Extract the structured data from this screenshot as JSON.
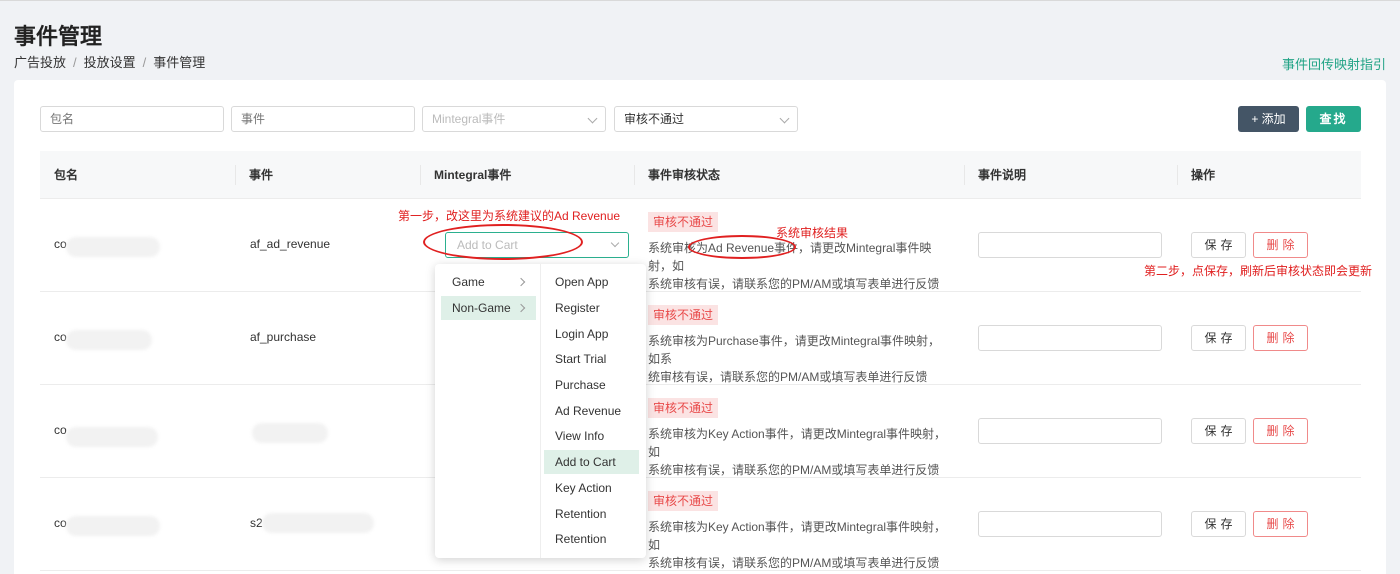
{
  "page": {
    "title": "事件管理",
    "breadcrumb": [
      "广告投放",
      "投放设置",
      "事件管理"
    ],
    "guide_link": "事件回传映射指引"
  },
  "filters": {
    "package_placeholder": "包名",
    "event_placeholder": "事件",
    "mintegral_placeholder": "Mintegral事件",
    "status_value": "审核不通过"
  },
  "buttons": {
    "add": "+ 添加",
    "search": "查找"
  },
  "table": {
    "headers": [
      "包名",
      "事件",
      "Mintegral事件",
      "事件审核状态",
      "事件说明",
      "操作"
    ],
    "rows": [
      {
        "package": "co",
        "event": "af_ad_revenue",
        "mintegral_placeholder": "Add to Cart",
        "status": "审核不通过",
        "msg_line1": "系统审核为Ad Revenue事件，请更改Mintegral事件映射，如",
        "msg_line2": "系统审核有误，请联系您的PM/AM或填写表单进行反馈",
        "save": "保存",
        "delete": "删除"
      },
      {
        "package": "co",
        "event": "af_purchase",
        "status": "审核不通过",
        "msg_line1": "系统审核为Purchase事件，请更改Mintegral事件映射，如系",
        "msg_line2": "统审核有误，请联系您的PM/AM或填写表单进行反馈",
        "save": "保存",
        "delete": "删除"
      },
      {
        "package": "co",
        "event": "",
        "status": "审核不通过",
        "msg_line1": "系统审核为Key Action事件，请更改Mintegral事件映射，如",
        "msg_line2": "系统审核有误，请联系您的PM/AM或填写表单进行反馈",
        "save": "保存",
        "delete": "删除"
      },
      {
        "package": "co",
        "event": "s2",
        "status": "审核不通过",
        "msg_line1": "系统审核为Key Action事件，请更改Mintegral事件映射，如",
        "msg_line2": "系统审核有误，请联系您的PM/AM或填写表单进行反馈",
        "save": "保存",
        "delete": "删除"
      }
    ]
  },
  "cascader": {
    "categories": [
      "Game",
      "Non-Game"
    ],
    "active_category": "Non-Game",
    "options": [
      "Open App",
      "Register",
      "Login App",
      "Start Trial",
      "Purchase",
      "Ad Revenue",
      "View Info",
      "Add to Cart",
      "Key Action",
      "Retention",
      "Retention"
    ],
    "selected_option": "Add to Cart"
  },
  "annotations": {
    "step1": "第一步，改这里为系统建议的Ad Revenue",
    "system_result": "系统审核结果",
    "step2": "第二步，点保存，刷新后审核状态即会更新"
  },
  "colors": {
    "accent": "#25a98c",
    "danger": "#e84a4a",
    "annotation": "#e02020",
    "add_button": "#445566"
  }
}
